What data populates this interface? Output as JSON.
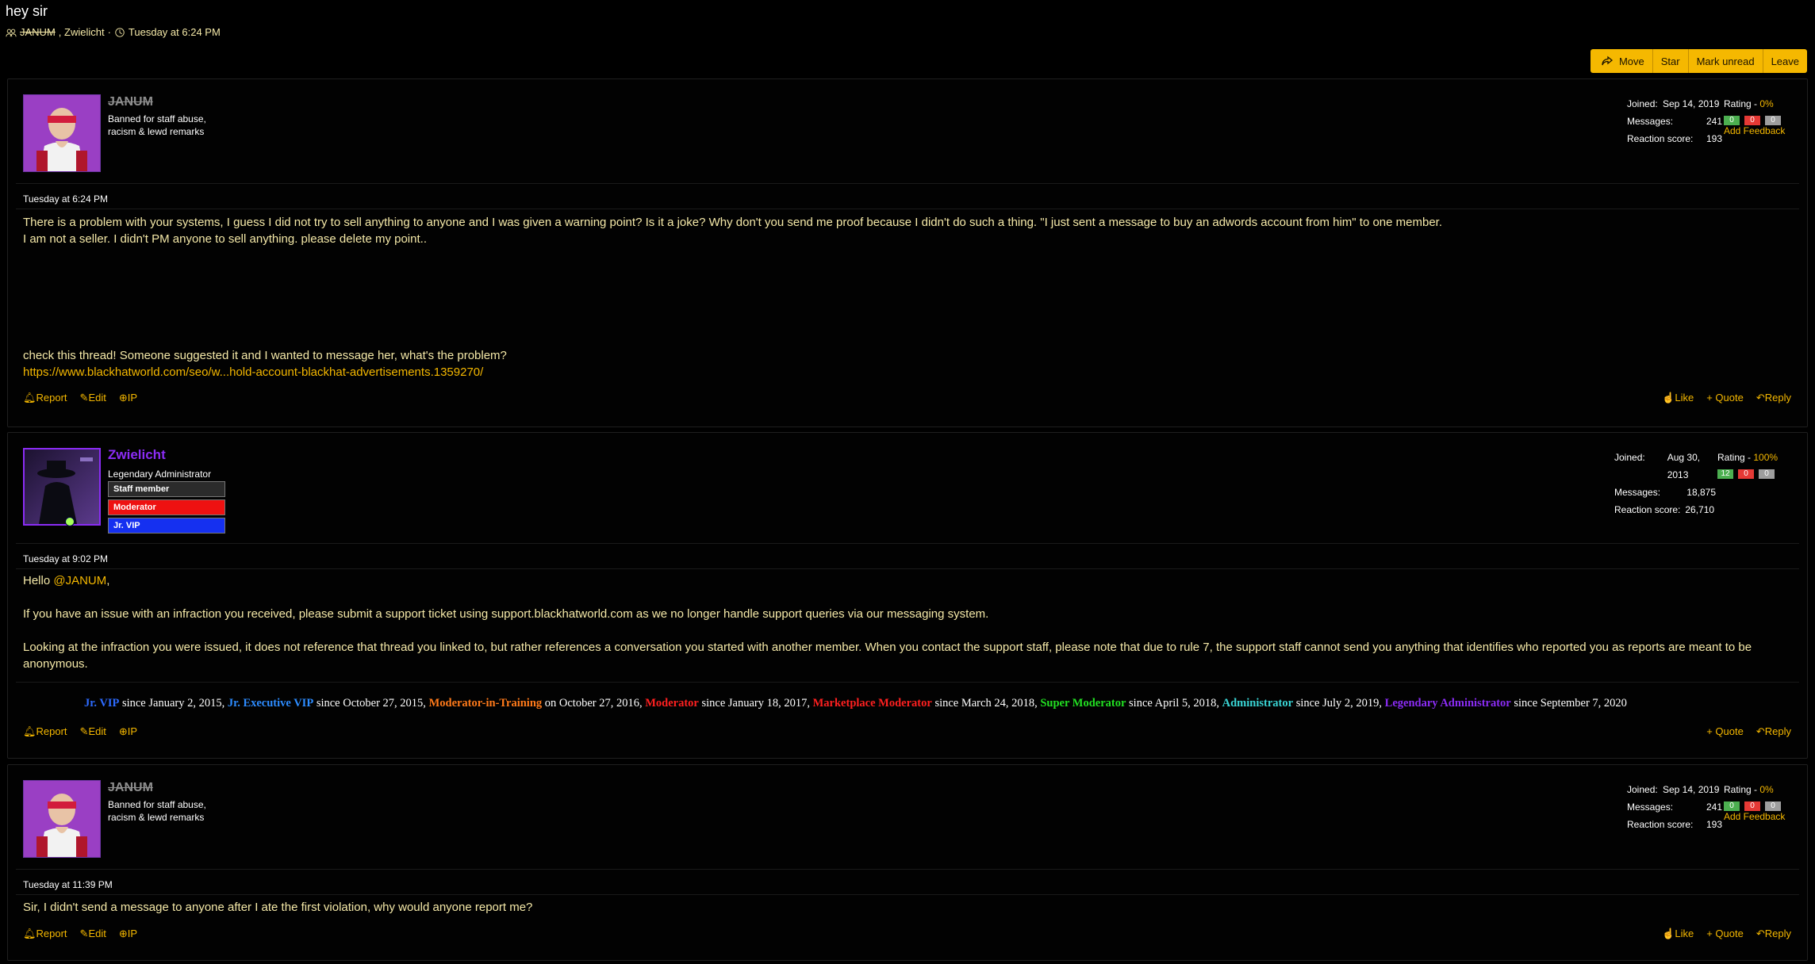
{
  "thread": {
    "title": "hey sir",
    "participant_1": "JANUM",
    "participant_sep": ", Zwielicht",
    "date_sep": " · ",
    "date": "Tuesday at 6:24 PM"
  },
  "toolbar": {
    "move": "Move",
    "star": "Star",
    "mark_unread": "Mark unread",
    "leave": "Leave"
  },
  "colors": {
    "accent": "#f5b800",
    "text": "#f5e9a8",
    "admin": "#8b2cf5"
  },
  "messages": [
    {
      "username": "JANUM",
      "user_title_1": "Banned for staff abuse,",
      "user_title_2": "racism & lewd remarks",
      "joined_label": "Joined:",
      "joined": "Sep 14, 2019",
      "messages_label": "Messages:",
      "messages": "241",
      "reaction_label": "Reaction score:",
      "reaction": "193",
      "rating_label": "Rating - ",
      "rating": "0%",
      "pill_pos": "0",
      "pill_neg": "0",
      "pill_neu": "0",
      "add_feedback": "Add Feedback",
      "date": "Tuesday at 6:24 PM",
      "line1": "There is a problem with your systems, I guess I did not try to sell anything to anyone and I was given a warning point? Is it a joke? Why don't you send me proof because I didn't do such a thing. \"I just sent a message to buy an adwords account from him\" to one member.",
      "line2": "I am not a seller. I didn't PM anyone to sell anything. please delete my point..",
      "line3": "check this thread! Someone suggested it and I wanted to message her, what's the problem?",
      "link": "https://www.blackhatworld.com/seo/w...hold-account-blackhat-advertisements.1359270/",
      "report": "Report",
      "edit": "Edit",
      "ip": "IP",
      "like": "Like",
      "quote": "Quote",
      "reply": "Reply"
    },
    {
      "username": "Zwielicht",
      "user_title": "Legendary Administrator",
      "banner_staff": "Staff member",
      "banner_mod": "Moderator",
      "banner_vip": "Jr. VIP",
      "joined_label": "Joined:",
      "joined": "Aug 30, 2013",
      "messages_label": "Messages:",
      "messages": "18,875",
      "reaction_label": "Reaction score:",
      "reaction": "26,710",
      "rating_label": "Rating - ",
      "rating": "100%",
      "pill_pos": "12",
      "pill_neg": "0",
      "pill_neu": "0",
      "date": "Tuesday at 9:02 PM",
      "hello": "Hello ",
      "mention": "@JANUM",
      "hello_end": ",",
      "para1": "If you have an issue with an infraction you received, please submit a support ticket using support.blackhatworld.com as we no longer handle support queries via our messaging system.",
      "para2": "Looking at the infraction you were issued, it does not reference that thread you linked to, but rather references a conversation you started with another member. When you contact the support staff, please note that due to rule 7, the support staff cannot send you anything that identifies who reported you as reports are meant to be anonymous.",
      "history": [
        {
          "rank": "Jr. VIP",
          "color": "#2d6bff",
          "text": " since January 2, 2015, "
        },
        {
          "rank": "Jr. Executive VIP",
          "color": "#2d8cff",
          "text": " since October 27, 2015, "
        },
        {
          "rank": "Moderator-in-Training",
          "color": "#ff7a1a",
          "text": " on October 27, 2016, "
        },
        {
          "rank": "Moderator",
          "color": "#ff2020",
          "text": " since January 18, 2017, "
        },
        {
          "rank": "Marketplace Moderator",
          "color": "#ff2020",
          "text": " since March 24, 2018, "
        },
        {
          "rank": "Super Moderator",
          "color": "#22e022",
          "text": " since April 5, 2018, "
        },
        {
          "rank": "Administrator",
          "color": "#3ad6d6",
          "text": " since July 2, 2019, "
        },
        {
          "rank": "Legendary Administrator",
          "color": "#8b2cf5",
          "text": " since September 7, 2020"
        }
      ],
      "report": "Report",
      "edit": "Edit",
      "ip": "IP",
      "quote": "Quote",
      "reply": "Reply"
    },
    {
      "username": "JANUM",
      "user_title_1": "Banned for staff abuse,",
      "user_title_2": "racism & lewd remarks",
      "joined_label": "Joined:",
      "joined": "Sep 14, 2019",
      "messages_label": "Messages:",
      "messages": "241",
      "reaction_label": "Reaction score:",
      "reaction": "193",
      "rating_label": "Rating - ",
      "rating": "0%",
      "pill_pos": "0",
      "pill_neg": "0",
      "pill_neu": "0",
      "add_feedback": "Add Feedback",
      "date": "Tuesday at 11:39 PM",
      "line1": "Sir, I didn't send a message to anyone after I ate the first violation, why would anyone report me?",
      "report": "Report",
      "edit": "Edit",
      "ip": "IP",
      "like": "Like",
      "quote": "Quote",
      "reply": "Reply"
    }
  ]
}
